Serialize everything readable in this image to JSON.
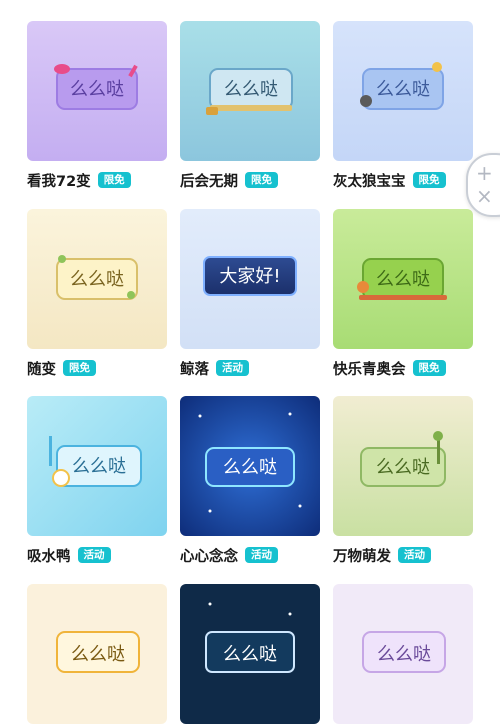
{
  "grid": [
    {
      "title": "看我72变",
      "badge": "限免",
      "bubble": "么么哒"
    },
    {
      "title": "后会无期",
      "badge": "限免",
      "bubble": "么么哒"
    },
    {
      "title": "灰太狼宝宝",
      "badge": "限免",
      "bubble": "么么哒"
    },
    {
      "title": "随变",
      "badge": "限免",
      "bubble": "么么哒"
    },
    {
      "title": "鲸落",
      "badge": "活动",
      "bubble": "大家好!"
    },
    {
      "title": "快乐青奥会",
      "badge": "限免",
      "bubble": "么么哒"
    },
    {
      "title": "吸水鸭",
      "badge": "活动",
      "bubble": "么么哒"
    },
    {
      "title": "心心念念",
      "badge": "活动",
      "bubble": "么么哒"
    },
    {
      "title": "万物萌发",
      "badge": "活动",
      "bubble": "么么哒"
    },
    {
      "bubble": "么么哒"
    },
    {
      "bubble": "么么哒"
    },
    {
      "bubble": "么么哒"
    }
  ],
  "zoom": {
    "plus": "+",
    "minus": "×"
  },
  "colors": {
    "badge": "#16c1cf"
  }
}
